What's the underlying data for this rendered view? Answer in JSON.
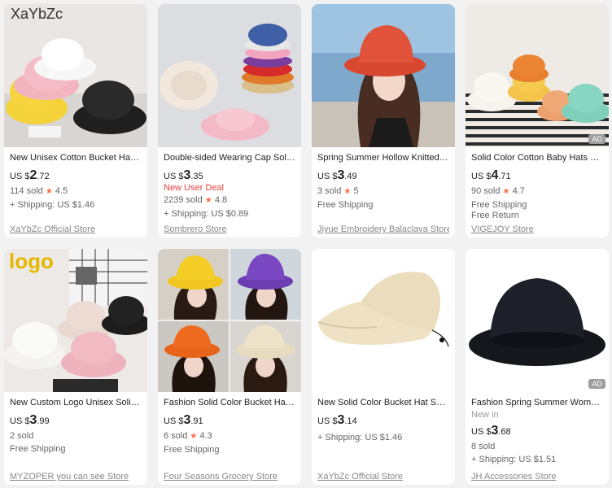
{
  "products": [
    {
      "title": "New Unisex Cotton Bucket Hats W...",
      "price": {
        "currency": "US $",
        "int": "2",
        "dec": ".72"
      },
      "sold": "114 sold",
      "rating": "4.5",
      "shipping": [
        "+ Shipping: US $1.46"
      ],
      "store": "XaYbZc Official Store",
      "image_text": "XaYbZc",
      "ad": ""
    },
    {
      "title": "Double-sided Wearing Cap Solid C...",
      "price": {
        "currency": "US $",
        "int": "3",
        "dec": ".35"
      },
      "deal": "New User Deal",
      "sold": "2239 sold",
      "rating": "4.8",
      "shipping": [
        "+ Shipping: US $0.89"
      ],
      "store": "Sombrero Store",
      "ad": ""
    },
    {
      "title": "Spring Summer Hollow Knitted Wo...",
      "price": {
        "currency": "US $",
        "int": "3",
        "dec": ".49"
      },
      "sold": "3 sold",
      "rating": "5",
      "shipping": [
        "Free Shipping"
      ],
      "store": "Jiyue Embroidery Balaclava Store",
      "ad": ""
    },
    {
      "title": "Solid Color Cotton Baby Hats Sprin...",
      "price": {
        "currency": "US $",
        "int": "4",
        "dec": ".71"
      },
      "sold": "90 sold",
      "rating": "4.7",
      "shipping": [
        "Free Shipping",
        "Free Return"
      ],
      "store": "VIGEJOY Store",
      "ad": "AD"
    },
    {
      "title": "New Custom Logo Unisex Solid Col...",
      "price": {
        "currency": "US $",
        "int": "3",
        "dec": ".99"
      },
      "sold": "2 sold",
      "rating": "",
      "shipping": [
        "Free Shipping"
      ],
      "store": "MYZOPER you can see Store",
      "image_text": "logo",
      "ad": ""
    },
    {
      "title": "Fashion Solid Color Bucket Hats fo...",
      "price": {
        "currency": "US $",
        "int": "3",
        "dec": ".91"
      },
      "sold": "6 sold",
      "rating": "4.3",
      "shipping": [
        "Free Shipping"
      ],
      "store": "Four Seasons Grocery Store",
      "ad": ""
    },
    {
      "title": "New Solid Color Bucket Hat Sunscr...",
      "price": {
        "currency": "US $",
        "int": "3",
        "dec": ".14"
      },
      "sold": "",
      "rating": "",
      "shipping": [
        "+ Shipping: US $1.46"
      ],
      "store": "XaYbZc Official Store",
      "ad": ""
    },
    {
      "title": "Fashion Spring Summer Women M...",
      "newin": "New in",
      "price": {
        "currency": "US $",
        "int": "3",
        "dec": ".68"
      },
      "sold": "8 sold",
      "rating": "",
      "shipping": [
        "+ Shipping: US $1.51"
      ],
      "store": "JH Accessories Store",
      "ad": "AD"
    }
  ],
  "rating_star": "★"
}
